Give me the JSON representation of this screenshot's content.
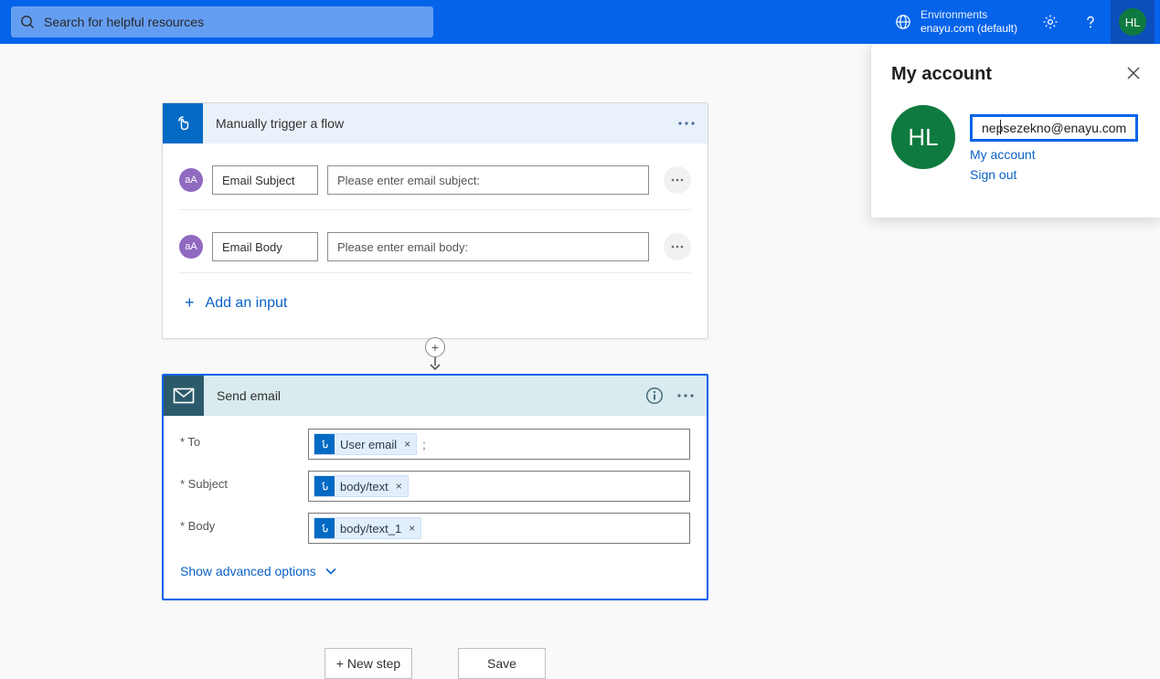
{
  "header": {
    "search_placeholder": "Search for helpful resources",
    "env_label": "Environments",
    "env_name": "enayu.com (default)",
    "avatar_initials": "HL"
  },
  "trigger": {
    "title": "Manually trigger a flow",
    "inputs": [
      {
        "icon": "aA",
        "name": "Email Subject",
        "placeholder": "Please enter email subject:"
      },
      {
        "icon": "aA",
        "name": "Email Body",
        "placeholder": "Please enter email body:"
      }
    ],
    "add_input": "Add an input"
  },
  "action": {
    "title": "Send email",
    "fields": {
      "to_label": "* To",
      "subject_label": "* Subject",
      "body_label": "* Body",
      "to_token": "User email",
      "subject_token": "body/text",
      "body_token": "body/text_1",
      "to_suffix": ";"
    },
    "advanced": "Show advanced options"
  },
  "buttons": {
    "new_step": "+ New step",
    "save": "Save"
  },
  "panel": {
    "title": "My account",
    "avatar_initials": "HL",
    "email": "nepsezekno@enayu.com",
    "link_account": "My account",
    "link_signout": "Sign out"
  }
}
